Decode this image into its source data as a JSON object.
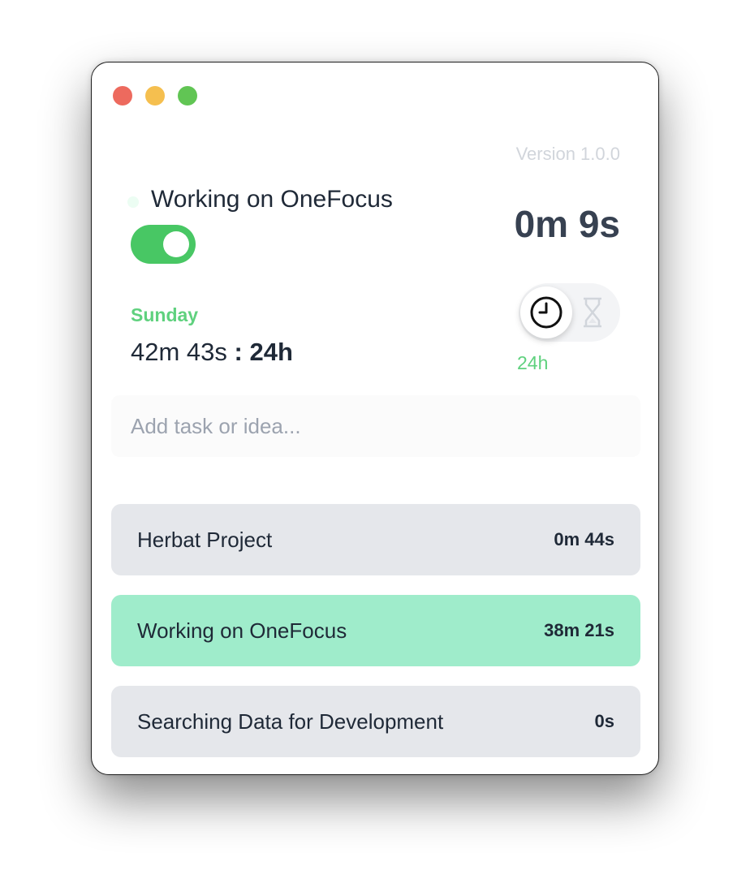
{
  "colors": {
    "traffic_close": "#ed6a5e",
    "traffic_minimize": "#f5bf4f",
    "traffic_maximize": "#61c554",
    "toggle_on": "#48c764",
    "accent_green": "#5fd17e",
    "task_default_bg": "#e5e7eb",
    "task_active_bg": "#9feccb"
  },
  "header": {
    "version": "Version 1.0.0"
  },
  "current": {
    "task_title": "Working on OneFocus",
    "toggle_on": true,
    "elapsed": "0m 9s"
  },
  "day": {
    "name": "Sunday",
    "total": "42m 43s",
    "separator": ":",
    "goal": "24h"
  },
  "mode": {
    "active": "clock-icon",
    "inactive": "hourglass-icon",
    "label": "24h"
  },
  "input": {
    "placeholder": "Add task or idea...",
    "value": ""
  },
  "tasks": [
    {
      "name": "Herbat Project",
      "time": "0m 44s",
      "active": false
    },
    {
      "name": "Working on OneFocus",
      "time": "38m 21s",
      "active": true
    },
    {
      "name": "Searching Data for Development",
      "time": "0s",
      "active": false
    }
  ]
}
